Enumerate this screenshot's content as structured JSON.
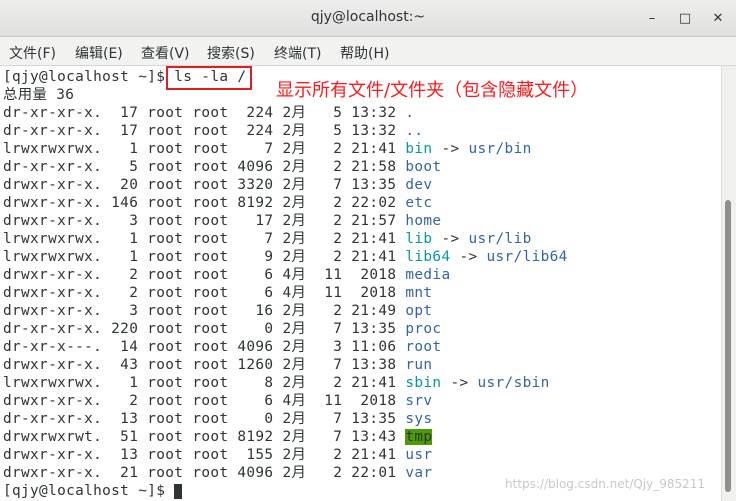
{
  "window": {
    "title": "qjy@localhost:~",
    "buttons": {
      "minimize": "–",
      "maximize": "□",
      "close": "✕"
    }
  },
  "menu": [
    "文件(F)",
    "编辑(E)",
    "查看(V)",
    "搜索(S)",
    "终端(T)",
    "帮助(H)"
  ],
  "terminal": {
    "prompt": "[qjy@localhost ~]$ ",
    "command": "ls -la /",
    "total": "总用量 36",
    "entries": [
      {
        "perm": "dr-xr-xr-x.",
        "links": "17",
        "owner": "root",
        "group": "root",
        "size": "224",
        "month": "2月",
        "day": "5",
        "time": "13:32",
        "name": ".",
        "kind": "dir"
      },
      {
        "perm": "dr-xr-xr-x.",
        "links": "17",
        "owner": "root",
        "group": "root",
        "size": "224",
        "month": "2月",
        "day": "5",
        "time": "13:32",
        "name": "..",
        "kind": "dir"
      },
      {
        "perm": "lrwxrwxrwx.",
        "links": "1",
        "owner": "root",
        "group": "root",
        "size": "7",
        "month": "2月",
        "day": "2",
        "time": "21:41",
        "name": "bin",
        "target": "usr/bin",
        "kind": "link"
      },
      {
        "perm": "dr-xr-xr-x.",
        "links": "5",
        "owner": "root",
        "group": "root",
        "size": "4096",
        "month": "2月",
        "day": "2",
        "time": "21:58",
        "name": "boot",
        "kind": "dir"
      },
      {
        "perm": "drwxr-xr-x.",
        "links": "20",
        "owner": "root",
        "group": "root",
        "size": "3320",
        "month": "2月",
        "day": "7",
        "time": "13:35",
        "name": "dev",
        "kind": "dir"
      },
      {
        "perm": "drwxr-xr-x.",
        "links": "146",
        "owner": "root",
        "group": "root",
        "size": "8192",
        "month": "2月",
        "day": "2",
        "time": "22:02",
        "name": "etc",
        "kind": "dir"
      },
      {
        "perm": "drwxr-xr-x.",
        "links": "3",
        "owner": "root",
        "group": "root",
        "size": "17",
        "month": "2月",
        "day": "2",
        "time": "21:57",
        "name": "home",
        "kind": "dir"
      },
      {
        "perm": "lrwxrwxrwx.",
        "links": "1",
        "owner": "root",
        "group": "root",
        "size": "7",
        "month": "2月",
        "day": "2",
        "time": "21:41",
        "name": "lib",
        "target": "usr/lib",
        "kind": "link"
      },
      {
        "perm": "lrwxrwxrwx.",
        "links": "1",
        "owner": "root",
        "group": "root",
        "size": "9",
        "month": "2月",
        "day": "2",
        "time": "21:41",
        "name": "lib64",
        "target": "usr/lib64",
        "kind": "link"
      },
      {
        "perm": "drwxr-xr-x.",
        "links": "2",
        "owner": "root",
        "group": "root",
        "size": "6",
        "month": "4月",
        "day": "11",
        "time": "2018",
        "name": "media",
        "kind": "dir"
      },
      {
        "perm": "drwxr-xr-x.",
        "links": "2",
        "owner": "root",
        "group": "root",
        "size": "6",
        "month": "4月",
        "day": "11",
        "time": "2018",
        "name": "mnt",
        "kind": "dir"
      },
      {
        "perm": "drwxr-xr-x.",
        "links": "3",
        "owner": "root",
        "group": "root",
        "size": "16",
        "month": "2月",
        "day": "2",
        "time": "21:49",
        "name": "opt",
        "kind": "dir"
      },
      {
        "perm": "dr-xr-xr-x.",
        "links": "220",
        "owner": "root",
        "group": "root",
        "size": "0",
        "month": "2月",
        "day": "7",
        "time": "13:35",
        "name": "proc",
        "kind": "dir"
      },
      {
        "perm": "dr-xr-x---.",
        "links": "14",
        "owner": "root",
        "group": "root",
        "size": "4096",
        "month": "2月",
        "day": "3",
        "time": "11:06",
        "name": "root",
        "kind": "dir"
      },
      {
        "perm": "drwxr-xr-x.",
        "links": "43",
        "owner": "root",
        "group": "root",
        "size": "1260",
        "month": "2月",
        "day": "7",
        "time": "13:38",
        "name": "run",
        "kind": "dir"
      },
      {
        "perm": "lrwxrwxrwx.",
        "links": "1",
        "owner": "root",
        "group": "root",
        "size": "8",
        "month": "2月",
        "day": "2",
        "time": "21:41",
        "name": "sbin",
        "target": "usr/sbin",
        "kind": "link"
      },
      {
        "perm": "drwxr-xr-x.",
        "links": "2",
        "owner": "root",
        "group": "root",
        "size": "6",
        "month": "4月",
        "day": "11",
        "time": "2018",
        "name": "srv",
        "kind": "dir"
      },
      {
        "perm": "dr-xr-xr-x.",
        "links": "13",
        "owner": "root",
        "group": "root",
        "size": "0",
        "month": "2月",
        "day": "7",
        "time": "13:35",
        "name": "sys",
        "kind": "dir"
      },
      {
        "perm": "drwxrwxrwt.",
        "links": "51",
        "owner": "root",
        "group": "root",
        "size": "8192",
        "month": "2月",
        "day": "7",
        "time": "13:43",
        "name": "tmp",
        "kind": "sticky"
      },
      {
        "perm": "drwxr-xr-x.",
        "links": "13",
        "owner": "root",
        "group": "root",
        "size": "155",
        "month": "2月",
        "day": "2",
        "time": "21:41",
        "name": "usr",
        "kind": "dir"
      },
      {
        "perm": "drwxr-xr-x.",
        "links": "21",
        "owner": "root",
        "group": "root",
        "size": "4096",
        "month": "2月",
        "day": "2",
        "time": "22:01",
        "name": "var",
        "kind": "dir"
      }
    ],
    "link_arrow": "->"
  },
  "annotation": "显示所有文件/文件夹（包含隐藏文件）",
  "watermark": "https://blog.csdn.net/Qjy_985211",
  "colors": {
    "dir": "#3465a4",
    "link": "#06989a",
    "sticky_bg": "#4e9a06",
    "annotation": "#ff1a1a"
  }
}
